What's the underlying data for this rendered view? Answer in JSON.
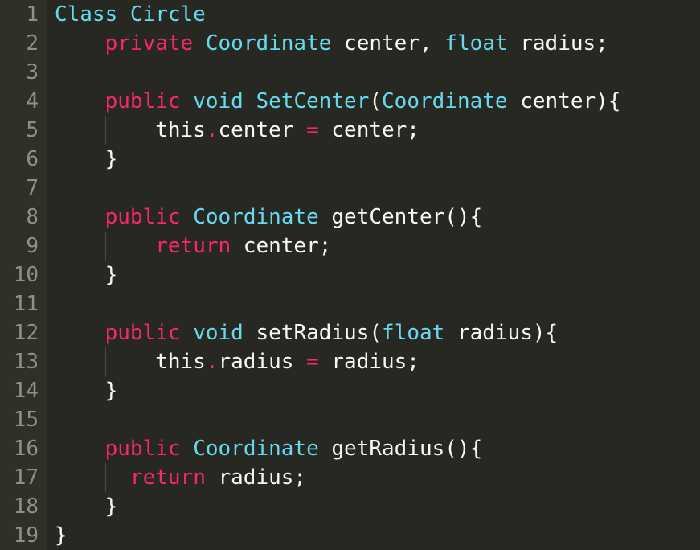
{
  "lines": [
    {
      "n": "1",
      "tokens": [
        {
          "t": "Class Circle",
          "c": "type"
        }
      ]
    },
    {
      "n": "2",
      "tokens": [
        {
          "t": "    ",
          "c": "plain"
        },
        {
          "t": "private",
          "c": "keyword"
        },
        {
          "t": " ",
          "c": "plain"
        },
        {
          "t": "Coordinate",
          "c": "type"
        },
        {
          "t": " center, ",
          "c": "plain"
        },
        {
          "t": "float",
          "c": "type"
        },
        {
          "t": " radius;",
          "c": "plain"
        }
      ]
    },
    {
      "n": "3",
      "tokens": []
    },
    {
      "n": "4",
      "tokens": [
        {
          "t": "    ",
          "c": "plain"
        },
        {
          "t": "public",
          "c": "keyword"
        },
        {
          "t": " ",
          "c": "plain"
        },
        {
          "t": "void",
          "c": "type"
        },
        {
          "t": " ",
          "c": "plain"
        },
        {
          "t": "SetCenter",
          "c": "func"
        },
        {
          "t": "(",
          "c": "plain"
        },
        {
          "t": "Coordinate",
          "c": "type"
        },
        {
          "t": " center){",
          "c": "plain"
        }
      ]
    },
    {
      "n": "5",
      "tokens": [
        {
          "t": "        this",
          "c": "plain"
        },
        {
          "t": ".",
          "c": "op"
        },
        {
          "t": "center ",
          "c": "plain"
        },
        {
          "t": "=",
          "c": "op"
        },
        {
          "t": " center;",
          "c": "plain"
        }
      ]
    },
    {
      "n": "6",
      "tokens": [
        {
          "t": "    }",
          "c": "plain"
        }
      ]
    },
    {
      "n": "7",
      "tokens": []
    },
    {
      "n": "8",
      "tokens": [
        {
          "t": "    ",
          "c": "plain"
        },
        {
          "t": "public",
          "c": "keyword"
        },
        {
          "t": " ",
          "c": "plain"
        },
        {
          "t": "Coordinate",
          "c": "type"
        },
        {
          "t": " getCenter(){",
          "c": "plain"
        }
      ]
    },
    {
      "n": "9",
      "tokens": [
        {
          "t": "        ",
          "c": "plain"
        },
        {
          "t": "return",
          "c": "keyword"
        },
        {
          "t": " center;",
          "c": "plain"
        }
      ]
    },
    {
      "n": "10",
      "tokens": [
        {
          "t": "    }",
          "c": "plain"
        }
      ]
    },
    {
      "n": "11",
      "tokens": []
    },
    {
      "n": "12",
      "tokens": [
        {
          "t": "    ",
          "c": "plain"
        },
        {
          "t": "public",
          "c": "keyword"
        },
        {
          "t": " ",
          "c": "plain"
        },
        {
          "t": "void",
          "c": "type"
        },
        {
          "t": " setRadius(",
          "c": "plain"
        },
        {
          "t": "float",
          "c": "type"
        },
        {
          "t": " radius){",
          "c": "plain"
        }
      ]
    },
    {
      "n": "13",
      "tokens": [
        {
          "t": "        this",
          "c": "plain"
        },
        {
          "t": ".",
          "c": "op"
        },
        {
          "t": "radius ",
          "c": "plain"
        },
        {
          "t": "=",
          "c": "op"
        },
        {
          "t": " radius;",
          "c": "plain"
        }
      ]
    },
    {
      "n": "14",
      "tokens": [
        {
          "t": "    }",
          "c": "plain"
        }
      ]
    },
    {
      "n": "15",
      "tokens": []
    },
    {
      "n": "16",
      "tokens": [
        {
          "t": "    ",
          "c": "plain"
        },
        {
          "t": "public",
          "c": "keyword"
        },
        {
          "t": " ",
          "c": "plain"
        },
        {
          "t": "Coordinate",
          "c": "type"
        },
        {
          "t": " getRadius(){",
          "c": "plain"
        }
      ]
    },
    {
      "n": "17",
      "tokens": [
        {
          "t": "      ",
          "c": "plain"
        },
        {
          "t": "return",
          "c": "keyword"
        },
        {
          "t": " radius;",
          "c": "plain"
        }
      ]
    },
    {
      "n": "18",
      "tokens": [
        {
          "t": "    }",
          "c": "plain"
        }
      ]
    },
    {
      "n": "19",
      "tokens": [
        {
          "t": "}",
          "c": "plain"
        }
      ]
    }
  ],
  "colors": {
    "background": "#272822",
    "gutter": "#2f3129",
    "line_number": "#8f908a",
    "keyword": "#f92672",
    "type": "#66d9ef",
    "text": "#f8f8f2"
  }
}
